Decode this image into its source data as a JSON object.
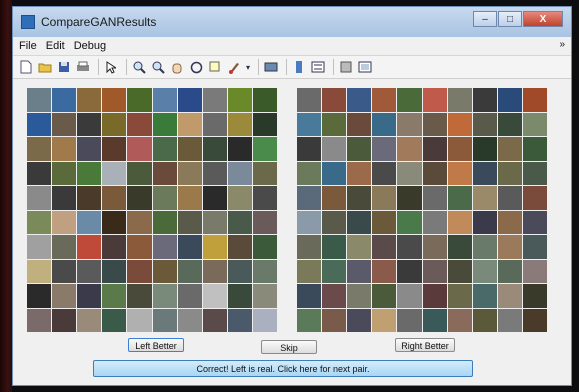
{
  "window": {
    "title": "CompareGANResults",
    "controls": [
      "–",
      "□",
      "X"
    ]
  },
  "menu": {
    "items": [
      "File",
      "Edit",
      "Debug"
    ],
    "overflow": "»"
  },
  "toolbar": {
    "icons": [
      "new-file-icon",
      "open-folder-icon",
      "save-icon",
      "print-icon",
      "pointer-icon",
      "zoom-in-icon",
      "zoom-out-icon",
      "pan-hand-icon",
      "rotate-icon",
      "data-cursor-icon",
      "brush-icon",
      "dropdown-arrow-icon",
      "link-icon",
      "colorbar-icon",
      "legend-icon",
      "grid-hide-icon",
      "grid-show-icon"
    ]
  },
  "left_grid": {
    "colors": [
      "#6b7f8a",
      "#3b6aa0",
      "#8a6a3a",
      "#a05a2a",
      "#4a6a2a",
      "#5a7fa8",
      "#2a4a8a",
      "#7a7a7a",
      "#6a8a2a",
      "#3a5a2a",
      "#2a5a9a",
      "#6a5a4a",
      "#3a3a3a",
      "#7a6a2a",
      "#8a4a3a",
      "#3a7a3a",
      "#c09a6a",
      "#6a6a6a",
      "#9a8a3a",
      "#2a3a2a",
      "#7a6a4a",
      "#a07a4a",
      "#4a4a5a",
      "#5a3a2a",
      "#b05a5a",
      "#4a6a4a",
      "#6a5a3a",
      "#3a4a3a",
      "#2a2a2a",
      "#4a8a4a",
      "#3a3a3a",
      "#5a6a3a",
      "#4a7a3a",
      "#aab0b8",
      "#4a5a3a",
      "#6a4a3a",
      "#8a7a5a",
      "#5a5a5a",
      "#7a8a9a",
      "#6a6a4a",
      "#8a8a8a",
      "#3a3a3a",
      "#4a3a2a",
      "#7a5a3a",
      "#3a3a2a",
      "#6a7a5a",
      "#9a7a4a",
      "#2a2a2a",
      "#8a8a6a",
      "#4a4a4a",
      "#7a8a5a",
      "#c0a080",
      "#6a8aa8",
      "#3a2a1a",
      "#8a6a4a",
      "#4a6a3a",
      "#5a5a4a",
      "#7a7a6a",
      "#4a5a4a",
      "#6a5a5a",
      "#a0a0a0",
      "#6a6a5a",
      "#c04a3a",
      "#4a3a3a",
      "#8a5a3a",
      "#6a6a7a",
      "#3a4a5a",
      "#c0a03a",
      "#5a4a3a",
      "#3a5a3a",
      "#c0b080",
      "#4a4a4a",
      "#5a5a5a",
      "#3a4a4a",
      "#7a4a3a",
      "#6a5a3a",
      "#5a6a5a",
      "#7a6a5a",
      "#4a5a5a",
      "#6a7a6a",
      "#2a2a2a",
      "#8a7a6a",
      "#3a3a4a",
      "#5a7a4a",
      "#4a4a3a",
      "#7a8a7a",
      "#6a6a6a",
      "#c0c0c0",
      "#3a4a3a",
      "#8a8a7a",
      "#7a6a6a",
      "#4a3a3a",
      "#9a8a7a",
      "#3a5a4a",
      "#b0b0b0",
      "#6a7a7a",
      "#8a8a8a",
      "#5a4a4a",
      "#4a5a6a",
      "#aab0c0"
    ]
  },
  "right_grid": {
    "colors": [
      "#6a6a6a",
      "#8a4a3a",
      "#3a5a8a",
      "#a05a3a",
      "#4a6a3a",
      "#c05a4a",
      "#7a7a6a",
      "#3a3a3a",
      "#2a4a7a",
      "#a04a2a",
      "#4a7a9a",
      "#5a6a3a",
      "#6a4a3a",
      "#3a6a8a",
      "#8a7a6a",
      "#6a5a4a",
      "#c06a3a",
      "#5a5a4a",
      "#3a4a3a",
      "#7a8a6a",
      "#3a3a3a",
      "#8a8a8a",
      "#4a5a3a",
      "#6a6a7a",
      "#a07a5a",
      "#4a3a3a",
      "#8a5a3a",
      "#2a3a2a",
      "#7a6a4a",
      "#3a5a3a",
      "#6a7a5a",
      "#3a6a8a",
      "#9a6a4a",
      "#4a4a4a",
      "#8a8a7a",
      "#5a4a3a",
      "#c07a4a",
      "#3a4a5a",
      "#6a6a4a",
      "#4a5a4a",
      "#5a6a7a",
      "#7a5a3a",
      "#4a4a3a",
      "#8a7a5a",
      "#3a3a2a",
      "#6a6a6a",
      "#4a6a4a",
      "#9a8a6a",
      "#5a5a5a",
      "#7a4a3a",
      "#8a9aa8",
      "#5a5a4a",
      "#3a4a4a",
      "#6a5a3a",
      "#4a7a4a",
      "#7a7a7a",
      "#c08a5a",
      "#3a3a4a",
      "#8a6a4a",
      "#4a4a5a",
      "#6a6a5a",
      "#3a5a4a",
      "#8a8a6a",
      "#5a4a4a",
      "#4a4a4a",
      "#7a6a5a",
      "#3a4a3a",
      "#6a7a6a",
      "#9a7a5a",
      "#4a5a5a",
      "#7a7a5a",
      "#4a6a5a",
      "#5a5a6a",
      "#8a5a4a",
      "#3a3a3a",
      "#6a5a5a",
      "#4a4a3a",
      "#7a8a7a",
      "#5a6a5a",
      "#8a7a7a",
      "#3a4a5a",
      "#6a4a4a",
      "#7a7a6a",
      "#4a5a3a",
      "#8a8a8a",
      "#5a3a3a",
      "#6a6a4a",
      "#4a6a6a",
      "#9a8a7a",
      "#3a3a2a",
      "#5a7a5a",
      "#7a5a4a",
      "#4a4a5a",
      "#c0a070",
      "#6a6a6a",
      "#3a5a5a",
      "#8a6a5a",
      "#5a5a3a",
      "#7a7a7a",
      "#4a3a2a"
    ]
  },
  "buttons": {
    "left": "Left Better",
    "skip": "Skip",
    "right": "Right Better"
  },
  "status": {
    "message": "Correct! Left is real. Click here for next pair."
  }
}
